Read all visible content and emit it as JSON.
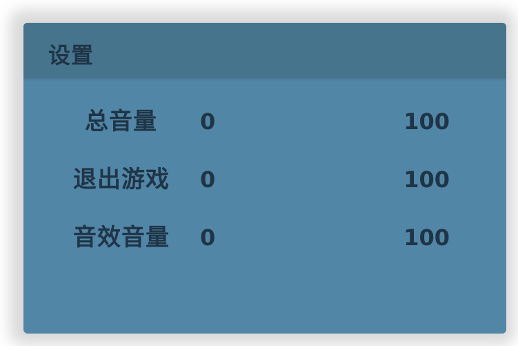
{
  "settings_panel": {
    "title": "设置",
    "rows": [
      {
        "label": "总音量",
        "min": "0",
        "max": "100"
      },
      {
        "label": "退出游戏",
        "min": "0",
        "max": "100"
      },
      {
        "label": "音效音量",
        "min": "0",
        "max": "100"
      }
    ]
  },
  "colors": {
    "panel_body": "#5286a6",
    "panel_header": "#47748d",
    "text": "#1f3547"
  }
}
